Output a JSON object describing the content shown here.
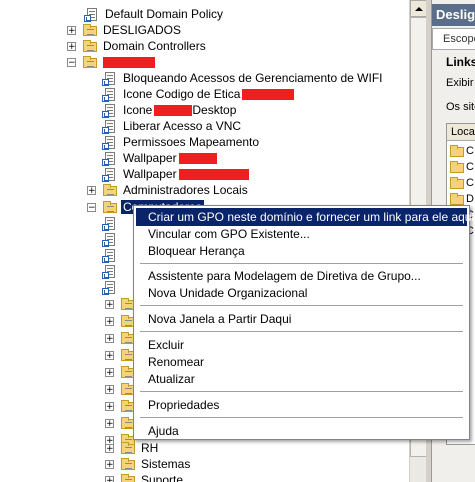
{
  "tree": {
    "items": [
      {
        "label": "Default Domain Policy",
        "icon": "gpo-link-icon",
        "expander": ""
      },
      {
        "label": "DESLIGADOS",
        "icon": "folder-icon",
        "expander": "+"
      },
      {
        "label": "Domain Controllers",
        "icon": "folder-icon",
        "expander": "+"
      },
      {
        "label": "",
        "icon": "folder-icon",
        "expander": "−",
        "redacted": true
      },
      {
        "label": "Bloqueando Acessos de Gerenciamento de WIFI",
        "icon": "gpo-link-icon"
      },
      {
        "label": "Icone Codigo de Etica",
        "icon": "gpo-link-icon"
      },
      {
        "label": "Icone",
        "label_suffix": "Desktop",
        "icon": "gpo-link-icon"
      },
      {
        "label": "Liberar Acesso a VNC",
        "icon": "gpo-link-icon"
      },
      {
        "label": "Permissoes Mapeamento",
        "icon": "gpo-link-icon"
      },
      {
        "label": "Wallpaper",
        "icon": "gpo-link-icon"
      },
      {
        "label": "Wallpaper",
        "icon": "gpo-link-icon"
      },
      {
        "label": "Administradores Locais",
        "icon": "folder-icon",
        "expander": "+"
      },
      {
        "label": "Computadores",
        "icon": "folder-icon",
        "expander": "−",
        "selected": true
      },
      {
        "label": "RH",
        "icon": "folder-icon",
        "expander": "+"
      },
      {
        "label": "Sistemas",
        "icon": "folder-icon",
        "expander": "+"
      },
      {
        "label": "Suporte",
        "icon": "folder-icon",
        "expander": "+"
      }
    ]
  },
  "right_pane": {
    "title": "Desligados",
    "scope_tab": "Escopo",
    "links_heading": "Links",
    "display_label": "Exibir links",
    "sites_label": "Os sites",
    "column_header": "Local",
    "rows": [
      "C",
      "C",
      "C",
      "D",
      "C",
      "C"
    ]
  },
  "context_menu": {
    "items": [
      {
        "label": "Criar um GPO neste domínio e fornecer um link para ele aqui...",
        "highlighted": true
      },
      {
        "label": "Vincular com GPO Existente..."
      },
      {
        "label": "Bloquear Herança"
      },
      {
        "sep": true
      },
      {
        "label": "Assistente para Modelagem de Diretiva de Grupo..."
      },
      {
        "label": "Nova Unidade Organizacional"
      },
      {
        "sep": true
      },
      {
        "label": "Nova Janela a Partir Daqui"
      },
      {
        "sep": true
      },
      {
        "label": "Excluir"
      },
      {
        "label": "Renomear"
      },
      {
        "label": "Atualizar"
      },
      {
        "sep": true
      },
      {
        "label": "Propriedades"
      },
      {
        "sep": true
      },
      {
        "label": "Ajuda"
      }
    ]
  },
  "colors": {
    "selection": "#0a246a",
    "redaction": "#f01e1e",
    "folder": "#f4d37a",
    "header": "#5a6e8c"
  }
}
